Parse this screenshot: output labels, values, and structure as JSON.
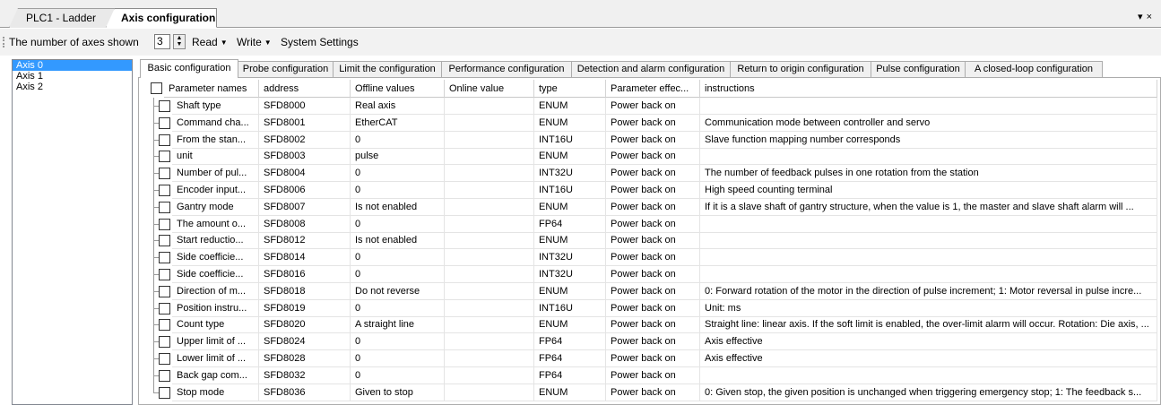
{
  "doc_tabs": [
    {
      "label": "PLC1 - Ladder",
      "active": false
    },
    {
      "label": "Axis configuration",
      "active": true
    }
  ],
  "tab_controls": {
    "dropdown": "▾",
    "close": "×"
  },
  "toolbar": {
    "axes_label": "The number of axes shown",
    "axes_value": "3",
    "read_label": "Read",
    "write_label": "Write",
    "system_settings_label": "System Settings"
  },
  "axes": [
    {
      "label": "Axis 0",
      "selected": true
    },
    {
      "label": "Axis 1",
      "selected": false
    },
    {
      "label": "Axis 2",
      "selected": false
    }
  ],
  "config_tabs": [
    {
      "label": "Basic configuration",
      "active": true
    },
    {
      "label": "Probe configuration",
      "active": false
    },
    {
      "label": "Limit the configuration",
      "active": false
    },
    {
      "label": "Performance configuration",
      "active": false
    },
    {
      "label": "Detection and alarm configuration",
      "active": false
    },
    {
      "label": "Return to origin configuration",
      "active": false
    },
    {
      "label": "Pulse configuration",
      "active": false
    },
    {
      "label": "A closed-loop configuration",
      "active": false
    }
  ],
  "table": {
    "headers": [
      "Parameter names",
      "address",
      "Offline values",
      "Online value",
      "type",
      "Parameter effec...",
      "instructions"
    ],
    "rows": [
      [
        "Shaft type",
        "SFD8000",
        "Real axis",
        "",
        "ENUM",
        "Power back on",
        ""
      ],
      [
        "Command cha...",
        "SFD8001",
        "EtherCAT",
        "",
        "ENUM",
        "Power back on",
        "Communication mode between controller and servo"
      ],
      [
        "From the stan...",
        "SFD8002",
        "0",
        "",
        "INT16U",
        "Power back on",
        "Slave function mapping number corresponds"
      ],
      [
        "unit",
        "SFD8003",
        "pulse",
        "",
        "ENUM",
        "Power back on",
        ""
      ],
      [
        "Number of pul...",
        "SFD8004",
        "0",
        "",
        "INT32U",
        "Power back on",
        "The number of feedback pulses in one rotation from the station"
      ],
      [
        "Encoder input...",
        "SFD8006",
        "0",
        "",
        "INT16U",
        "Power back on",
        "High speed counting terminal"
      ],
      [
        "Gantry mode",
        "SFD8007",
        "Is not enabled",
        "",
        "ENUM",
        "Power back on",
        "If it is a slave shaft of gantry structure, when the value is 1, the master and slave shaft alarm will ..."
      ],
      [
        "The amount o...",
        "SFD8008",
        "0",
        "",
        "FP64",
        "Power back on",
        ""
      ],
      [
        "Start reductio...",
        "SFD8012",
        "Is not enabled",
        "",
        "ENUM",
        "Power back on",
        ""
      ],
      [
        "Side coefficie...",
        "SFD8014",
        "0",
        "",
        "INT32U",
        "Power back on",
        ""
      ],
      [
        "Side coefficie...",
        "SFD8016",
        "0",
        "",
        "INT32U",
        "Power back on",
        ""
      ],
      [
        "Direction of m...",
        "SFD8018",
        "Do not reverse",
        "",
        "ENUM",
        "Power back on",
        "0: Forward rotation of the motor in the direction of pulse increment; 1: Motor reversal in pulse incre..."
      ],
      [
        "Position instru...",
        "SFD8019",
        "0",
        "",
        "INT16U",
        "Power back on",
        "Unit: ms"
      ],
      [
        "Count type",
        "SFD8020",
        "A straight line",
        "",
        "ENUM",
        "Power back on",
        "Straight line: linear axis. If the soft limit is enabled, the over-limit alarm will occur. Rotation: Die axis, ..."
      ],
      [
        "Upper limit of ...",
        "SFD8024",
        "0",
        "",
        "FP64",
        "Power back on",
        "Axis effective"
      ],
      [
        "Lower limit of ...",
        "SFD8028",
        "0",
        "",
        "FP64",
        "Power back on",
        "Axis effective"
      ],
      [
        "Back gap com...",
        "SFD8032",
        "0",
        "",
        "FP64",
        "Power back on",
        ""
      ],
      [
        "Stop mode",
        "SFD8036",
        "Given to stop",
        "",
        "ENUM",
        "Power back on",
        "0: Given stop, the given position is unchanged when triggering emergency stop; 1: The feedback s..."
      ]
    ]
  }
}
